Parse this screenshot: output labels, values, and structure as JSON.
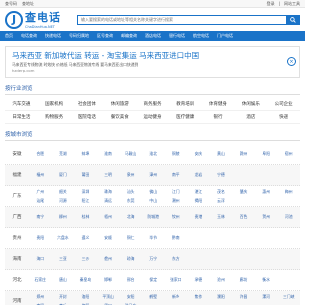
{
  "topbar": {
    "links": [
      "查号码",
      "查地址"
    ],
    "right": [
      "登录",
      "|",
      "网站工具"
    ]
  },
  "logo": {
    "main": "查电话",
    "sub": "ChaDianHua.NET"
  },
  "search": {
    "placeholder": "输入要搜索的电话或地址等相关名称关键字进行搜索",
    "button": "🔍"
  },
  "nav": [
    "首页",
    "电话查询",
    "快递电话",
    "号码归属地",
    "区号查询",
    "邮编查询",
    "酒店电话",
    "银行电话",
    "航空电话",
    "门户电话"
  ],
  "ad": {
    "title": "马来西亚 新加坡代运 转运 - 淘宝集运 马来西亚进口中国",
    "desc": "马来西亚专线物流 时效快 价格低 马来西亚物流专线 要马来西亚出口快递到",
    "url": "hzderp.com",
    "close": "×"
  },
  "industry_title": "按行业浏览",
  "industries": [
    "汽车交通",
    "国家机构",
    "社会团体",
    "休闲旅游",
    "商务服务",
    "教育培训",
    "体育健身",
    "休闲娱乐",
    "公司企业",
    "日常生活",
    "购物服务",
    "医院电话",
    "餐饮美食",
    "运动健身",
    "医疗健康",
    "银行",
    "酒店",
    "快递"
  ],
  "city_title": "按城市浏览",
  "provinces": [
    {
      "name": "安徽",
      "cities": [
        "合肥",
        "芜湖",
        "蚌埠",
        "淮南",
        "马鞍山",
        "淮北",
        "铜陵",
        "安庆",
        "黄山",
        "滁州",
        "阜阳",
        "宿州"
      ]
    },
    {
      "name": "福建",
      "cities": [
        "福州",
        "厦门",
        "莆田",
        "三明",
        "泉州",
        "漳州",
        "南平",
        "龙岩",
        "宁德",
        "",
        "",
        ""
      ]
    },
    {
      "name": "广东",
      "cities": [
        "广州",
        "韶关",
        "深圳",
        "珠海",
        "汕头",
        "佛山",
        "江门",
        "湛江",
        "茂名",
        "肇庆",
        "惠州",
        "梅州",
        "汕尾",
        "河源",
        "阳江",
        "清远",
        "东莞",
        "中山",
        "潮州",
        "揭阳",
        "云浮",
        "",
        "",
        ""
      ]
    },
    {
      "name": "广西",
      "cities": [
        "南宁",
        "柳州",
        "桂林",
        "梧州",
        "北海",
        "防城港",
        "钦州",
        "贵港",
        "玉林",
        "百色",
        "贺州",
        "河池"
      ]
    },
    {
      "name": "贵州",
      "cities": [
        "贵阳",
        "六盘水",
        "遵义",
        "安顺",
        "铜仁",
        "毕节",
        "黔南",
        "",
        "",
        "",
        "",
        ""
      ]
    },
    {
      "name": "海南",
      "cities": [
        "海口",
        "三亚",
        "三沙",
        "儋州",
        "琼海",
        "万宁",
        "东方",
        "",
        "",
        "",
        "",
        ""
      ]
    },
    {
      "name": "河北",
      "cities": [
        "石家庄",
        "唐山",
        "秦皇岛",
        "邯郸",
        "邢台",
        "保定",
        "张家口",
        "承德",
        "沧州",
        "廊坊",
        "衡水",
        ""
      ]
    },
    {
      "name": "河南",
      "cities": [
        "郑州",
        "开封",
        "洛阳",
        "平顶山",
        "安阳",
        "鹤壁",
        "新乡",
        "焦作",
        "濮阳",
        "许昌",
        "漯河",
        "三门峡",
        "南阳",
        "商丘",
        "信阳",
        "周口",
        "驻马店",
        "",
        "",
        "",
        "",
        "",
        "",
        ""
      ]
    }
  ]
}
